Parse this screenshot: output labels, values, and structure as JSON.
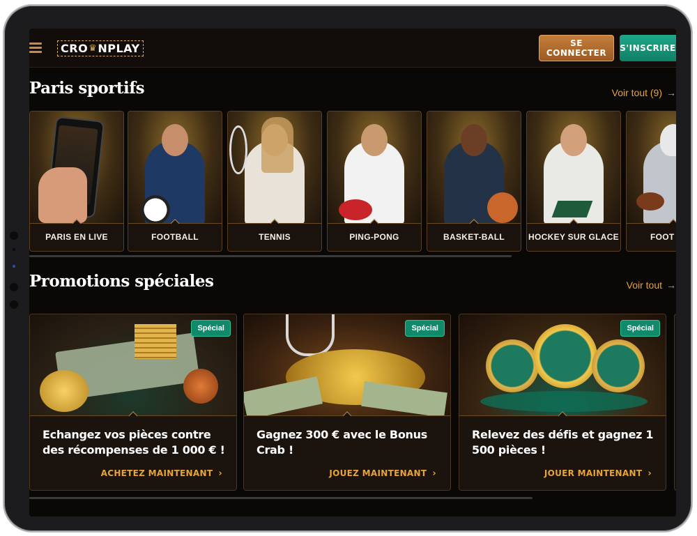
{
  "header": {
    "logo_left": "CRO",
    "logo_right": "NPLAY",
    "login_label": "SE CONNECTER",
    "signup_label": "S'INSCRIRE"
  },
  "sports": {
    "title": "Paris sportifs",
    "see_all": "Voir tout (9)",
    "items": [
      {
        "label": "PARIS EN LIVE"
      },
      {
        "label": "FOOTBALL"
      },
      {
        "label": "TENNIS"
      },
      {
        "label": "PING-PONG"
      },
      {
        "label": "BASKET-BALL"
      },
      {
        "label": "HOCKEY SUR GLACE"
      },
      {
        "label": "FOOT AMÉR"
      }
    ]
  },
  "promos": {
    "title": "Promotions spéciales",
    "see_all": "Voir tout",
    "items": [
      {
        "badge": "Spécial",
        "text": "Echangez vos pièces contre des récompenses de 1 000 € !",
        "cta": "ACHETEZ MAINTENANT"
      },
      {
        "badge": "Spécial",
        "text": "Gagnez 300 € avec le Bonus Crab !",
        "cta": "JOUEZ MAINTENANT"
      },
      {
        "badge": "Spécial",
        "text": "Relevez des défis et gagnez 1 500 pièces !",
        "cta": "JOUER MAINTENANT"
      }
    ]
  },
  "icons": {
    "menu": "hamburger-menu-icon",
    "crown": "crown-icon",
    "arrow": "arrow-right-icon",
    "chevron": "chevron-right-icon"
  },
  "colors": {
    "accent_gold": "#e6a43a",
    "login_button": "#b06a2c",
    "signup_button": "#14967a",
    "background": "#0a0807"
  }
}
